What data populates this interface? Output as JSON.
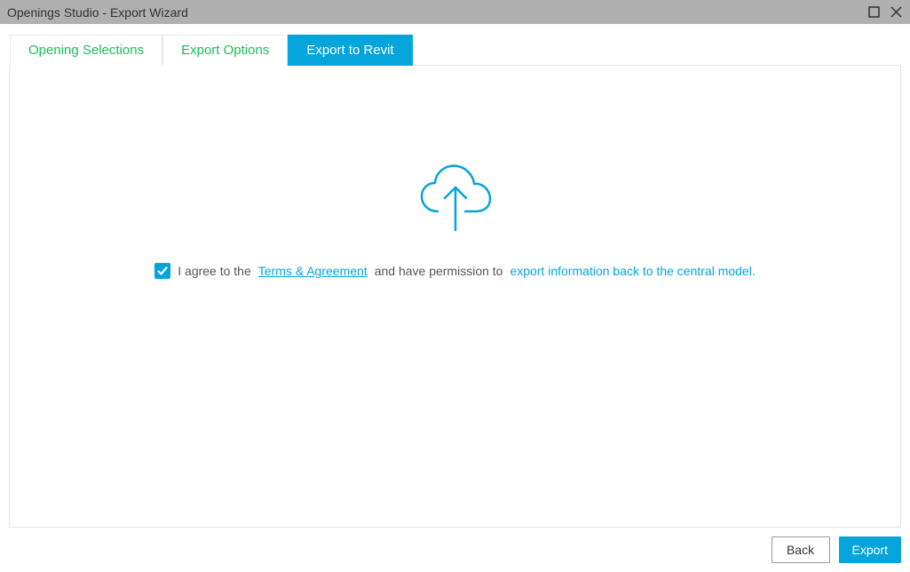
{
  "window": {
    "title": "Openings Studio - Export Wizard"
  },
  "tabs": {
    "opening_selections": "Opening Selections",
    "export_options": "Export Options",
    "export_to_revit": "Export to Revit"
  },
  "agreement": {
    "prefix": "I agree to the",
    "terms_link": "Terms & Agreement",
    "middle": "and have permission to",
    "export_link": "export information back to the central model."
  },
  "footer": {
    "back": "Back",
    "export": "Export"
  },
  "colors": {
    "accent": "#05a4db",
    "tab_inactive": "#1fba5a"
  }
}
